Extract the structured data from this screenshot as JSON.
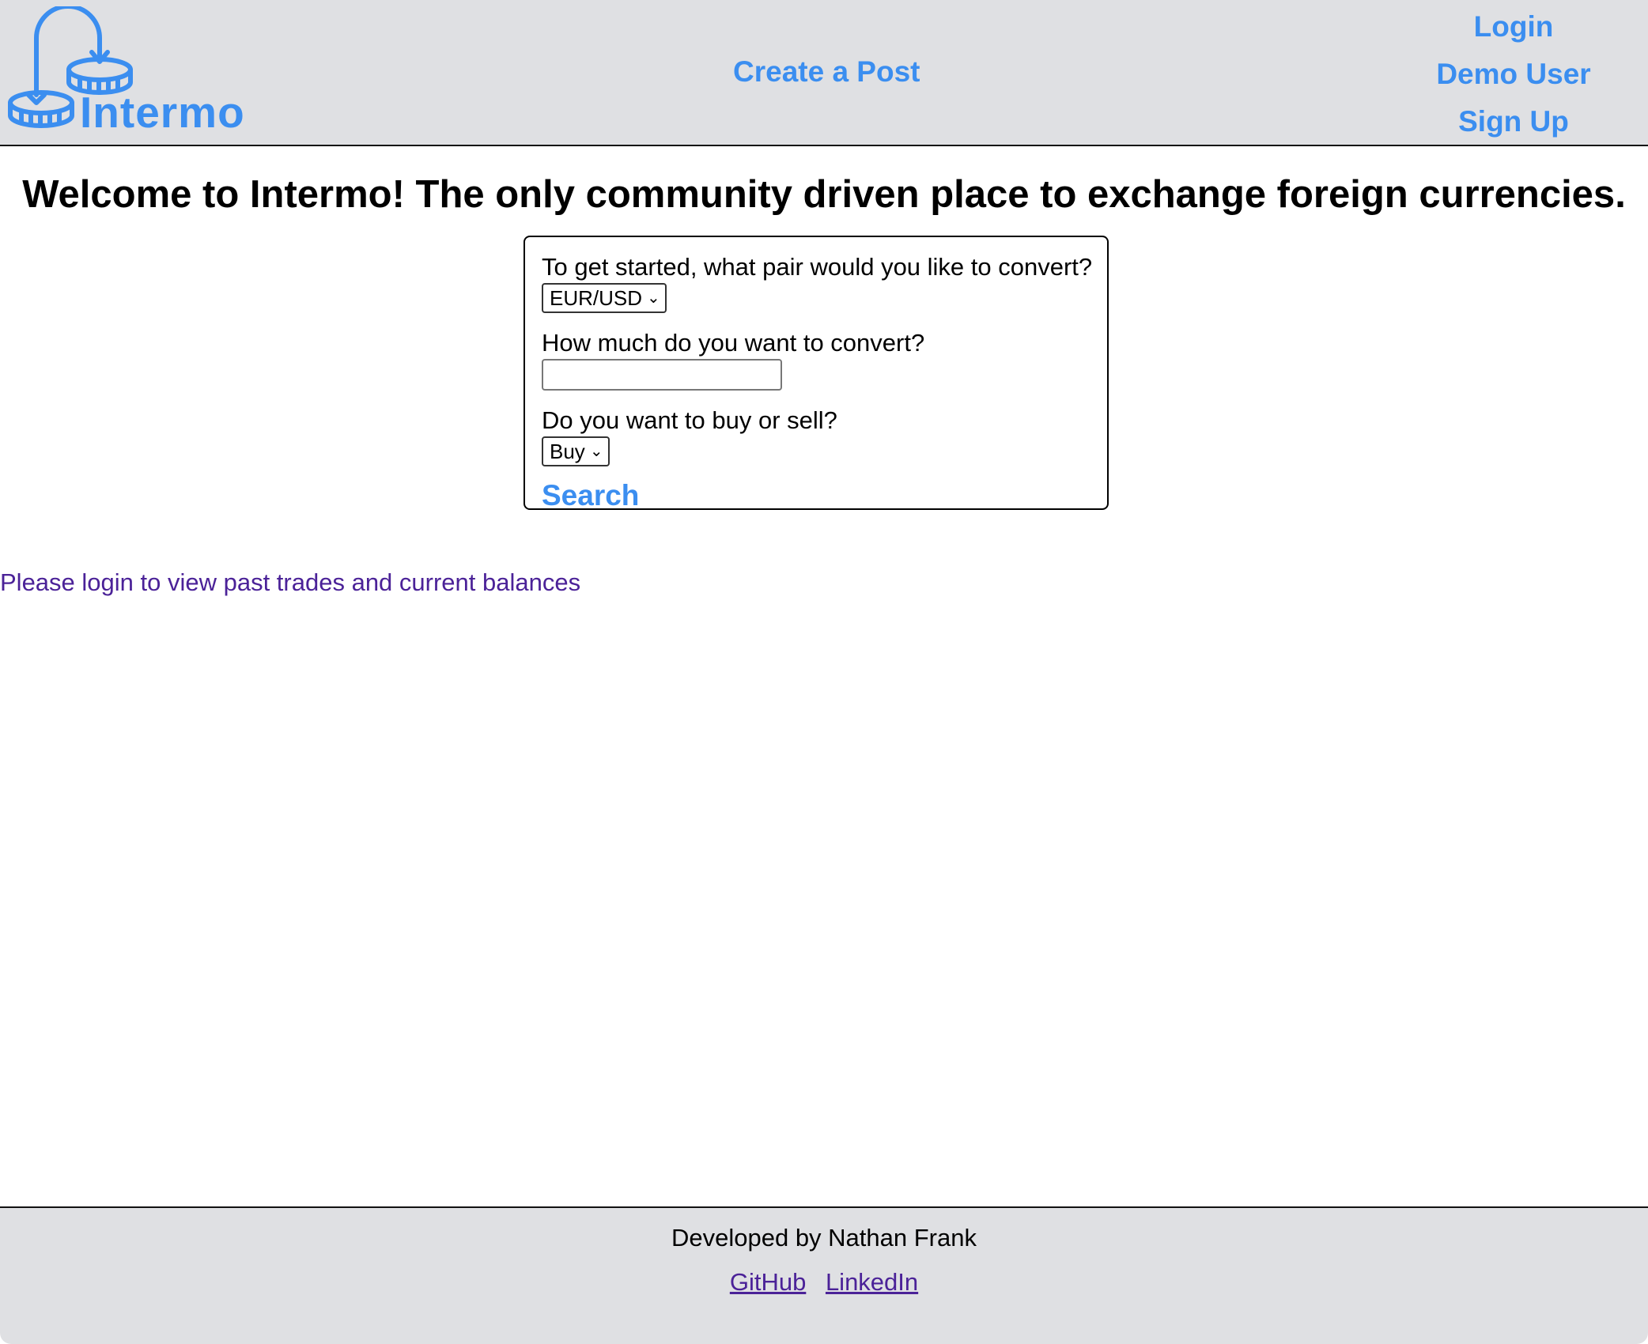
{
  "header": {
    "logo_text": "Intermo",
    "nav_center": "Create a Post",
    "nav_right": [
      "Login",
      "Demo User",
      "Sign Up"
    ]
  },
  "main": {
    "welcome": "Welcome to Intermo! The only community driven place to exchange foreign currencies.",
    "form": {
      "pair_label": "To get started, what pair would you like to convert?",
      "pair_value": "EUR/USD",
      "amount_label": "How much do you want to convert?",
      "amount_value": "",
      "side_label": "Do you want to buy or sell?",
      "side_value": "Buy",
      "search_label": "Search"
    },
    "login_message": "Please login to view past trades and current balances"
  },
  "footer": {
    "credit": "Developed by Nathan Frank",
    "links": [
      "GitHub",
      "LinkedIn"
    ]
  },
  "colors": {
    "accent": "#3b8ef0",
    "link_visited": "#4b2298",
    "bar_bg": "#dfe0e3"
  }
}
